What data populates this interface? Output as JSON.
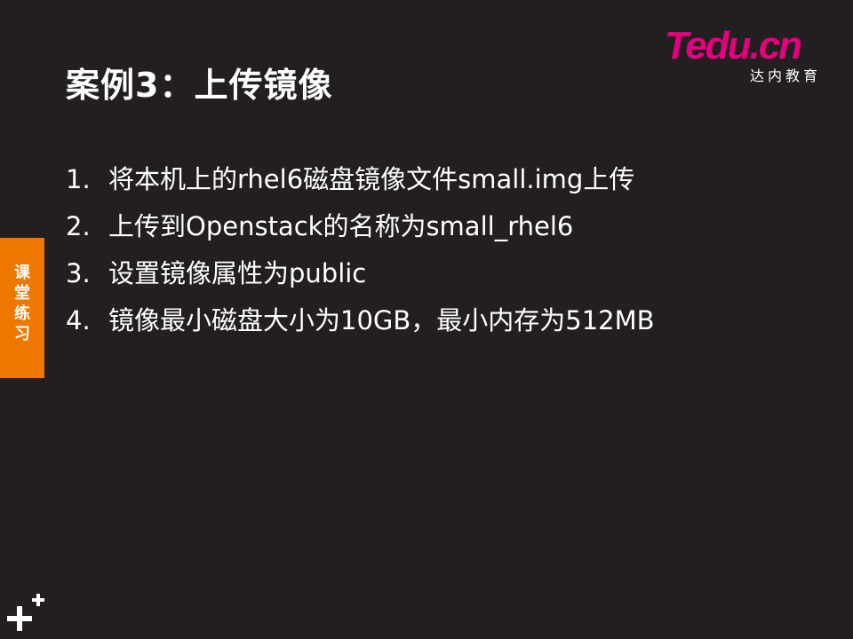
{
  "slide": {
    "title": "案例3：上传镜像",
    "logo": {
      "brand": "Tedu.cn",
      "subtitle": "达内教育"
    },
    "items": [
      {
        "num": "1.",
        "text": "将本机上的rhel6磁盘镜像文件small.img上传"
      },
      {
        "num": "2.",
        "text": "上传到Openstack的名称为small_rhel6"
      },
      {
        "num": "3.",
        "text": "设置镜像属性为public"
      },
      {
        "num": "4.",
        "text": "镜像最小磁盘大小为10GB，最小内存为512MB"
      }
    ],
    "side_tab": "课\n堂\n练\n习"
  },
  "colors": {
    "background": "#231f20",
    "accent": "#ee7700",
    "brand": "#e6007e",
    "text": "#ffffff"
  },
  "icons": {
    "corner": "plus-icon"
  }
}
